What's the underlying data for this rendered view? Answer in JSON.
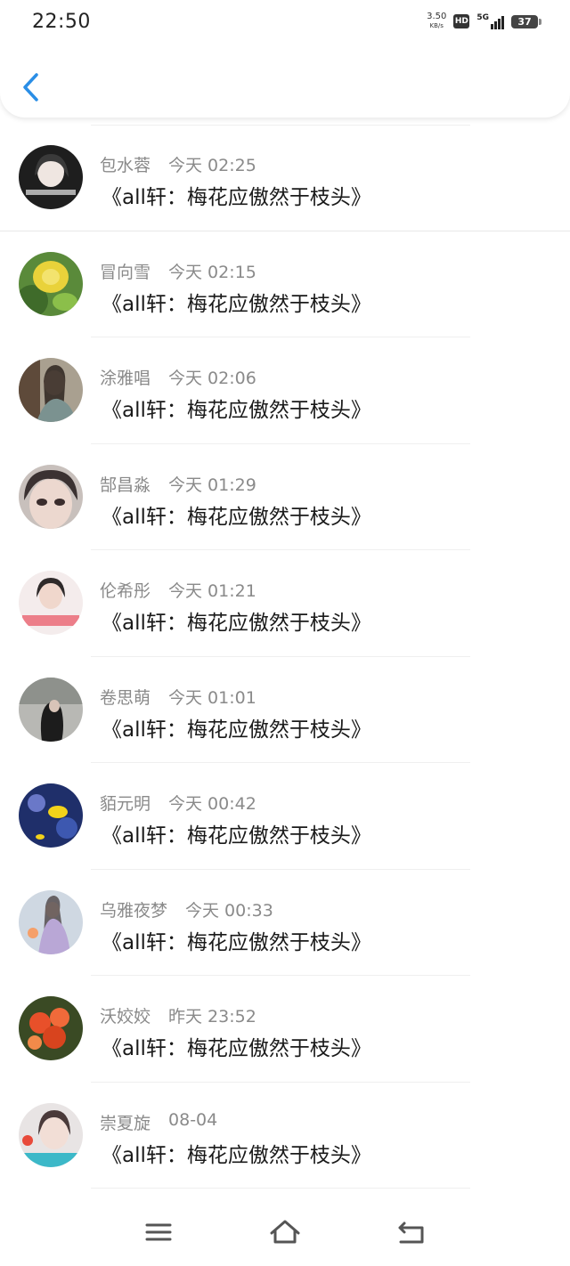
{
  "status_bar": {
    "time": "22:50",
    "net_speed_value": "3.50",
    "net_speed_unit": "KB/s",
    "hd_badge": "HD",
    "network": "5G",
    "battery": "37"
  },
  "header": {
    "back_icon": "chevron-left-icon",
    "accent_color": "#2a8ee6"
  },
  "messages": [
    {
      "name": "包水蓉",
      "time": "今天 02:25",
      "text": "《all轩：梅花应傲然于枝头》"
    },
    {
      "name": "冒向雪",
      "time": "今天 02:15",
      "text": "《all轩：梅花应傲然于枝头》"
    },
    {
      "name": "涂雅唱",
      "time": "今天 02:06",
      "text": "《all轩：梅花应傲然于枝头》"
    },
    {
      "name": "郜昌淼",
      "time": "今天 01:29",
      "text": "《all轩：梅花应傲然于枝头》"
    },
    {
      "name": "伦希彤",
      "time": "今天 01:21",
      "text": "《all轩：梅花应傲然于枝头》"
    },
    {
      "name": "卷思萌",
      "time": "今天 01:01",
      "text": "《all轩：梅花应傲然于枝头》"
    },
    {
      "name": "貊元明",
      "time": "今天 00:42",
      "text": "《all轩：梅花应傲然于枝头》"
    },
    {
      "name": "乌雅夜梦",
      "time": "今天 00:33",
      "text": "《all轩：梅花应傲然于枝头》"
    },
    {
      "name": "沃姣姣",
      "time": "昨天 23:52",
      "text": "《all轩：梅花应傲然于枝头》"
    },
    {
      "name": "崇夏旋",
      "time": "08-04",
      "text": "《all轩：梅花应傲然于枝头》"
    }
  ],
  "nav_bar": {
    "menu_icon": "menu-icon",
    "home_icon": "home-icon",
    "back_icon": "return-icon"
  }
}
